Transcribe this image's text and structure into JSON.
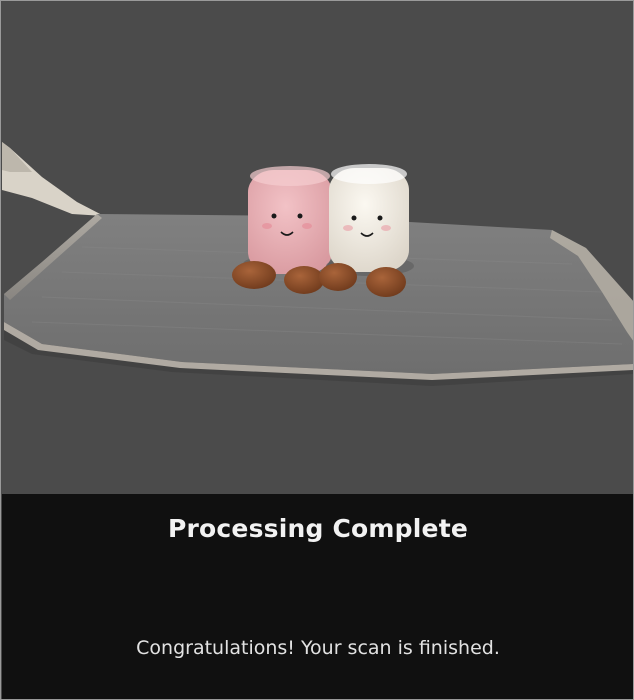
{
  "preview": {
    "model_icon": "3d-scan-model",
    "background_color": "#4b4b4b"
  },
  "status_panel": {
    "title": "Processing Complete",
    "message": "Congratulations! Your scan is finished."
  }
}
